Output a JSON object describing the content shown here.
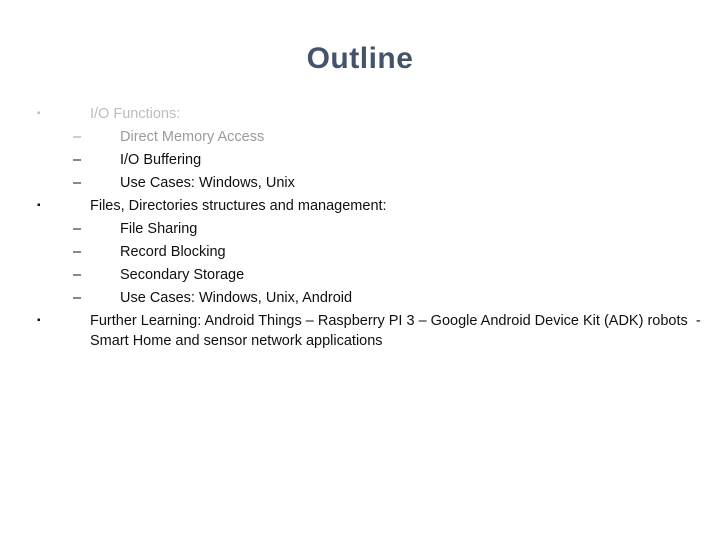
{
  "slide": {
    "title": "Outline",
    "title_color": "#44526b",
    "background_color": "#ffffff",
    "markers": {
      "level1": "▪",
      "level2": "–"
    },
    "tones": {
      "faint": "#bcbcbc",
      "mid": "#9b9b9b",
      "solid": "#101010"
    },
    "outline": [
      {
        "level": 1,
        "text": "I/O Functions:",
        "tone": "faint"
      },
      {
        "level": 2,
        "text": "Direct Memory Access",
        "tone": "mid"
      },
      {
        "level": 2,
        "text": "I/O Buffering",
        "tone": "solid"
      },
      {
        "level": 2,
        "text": "Use Cases: Windows, Unix",
        "tone": "solid"
      },
      {
        "level": 1,
        "text": "Files, Directories structures and management:",
        "tone": "solid"
      },
      {
        "level": 2,
        "text": "File Sharing",
        "tone": "solid"
      },
      {
        "level": 2,
        "text": "Record Blocking",
        "tone": "solid"
      },
      {
        "level": 2,
        "text": "Secondary Storage",
        "tone": "solid"
      },
      {
        "level": 2,
        "text": "Use Cases: Windows, Unix, Android",
        "tone": "solid"
      },
      {
        "level": 1,
        "text": "Further Learning: Android Things – Raspberry PI 3 – Google Android Device Kit (ADK) robots  - Smart Home and sensor network applications",
        "tone": "solid"
      }
    ]
  }
}
